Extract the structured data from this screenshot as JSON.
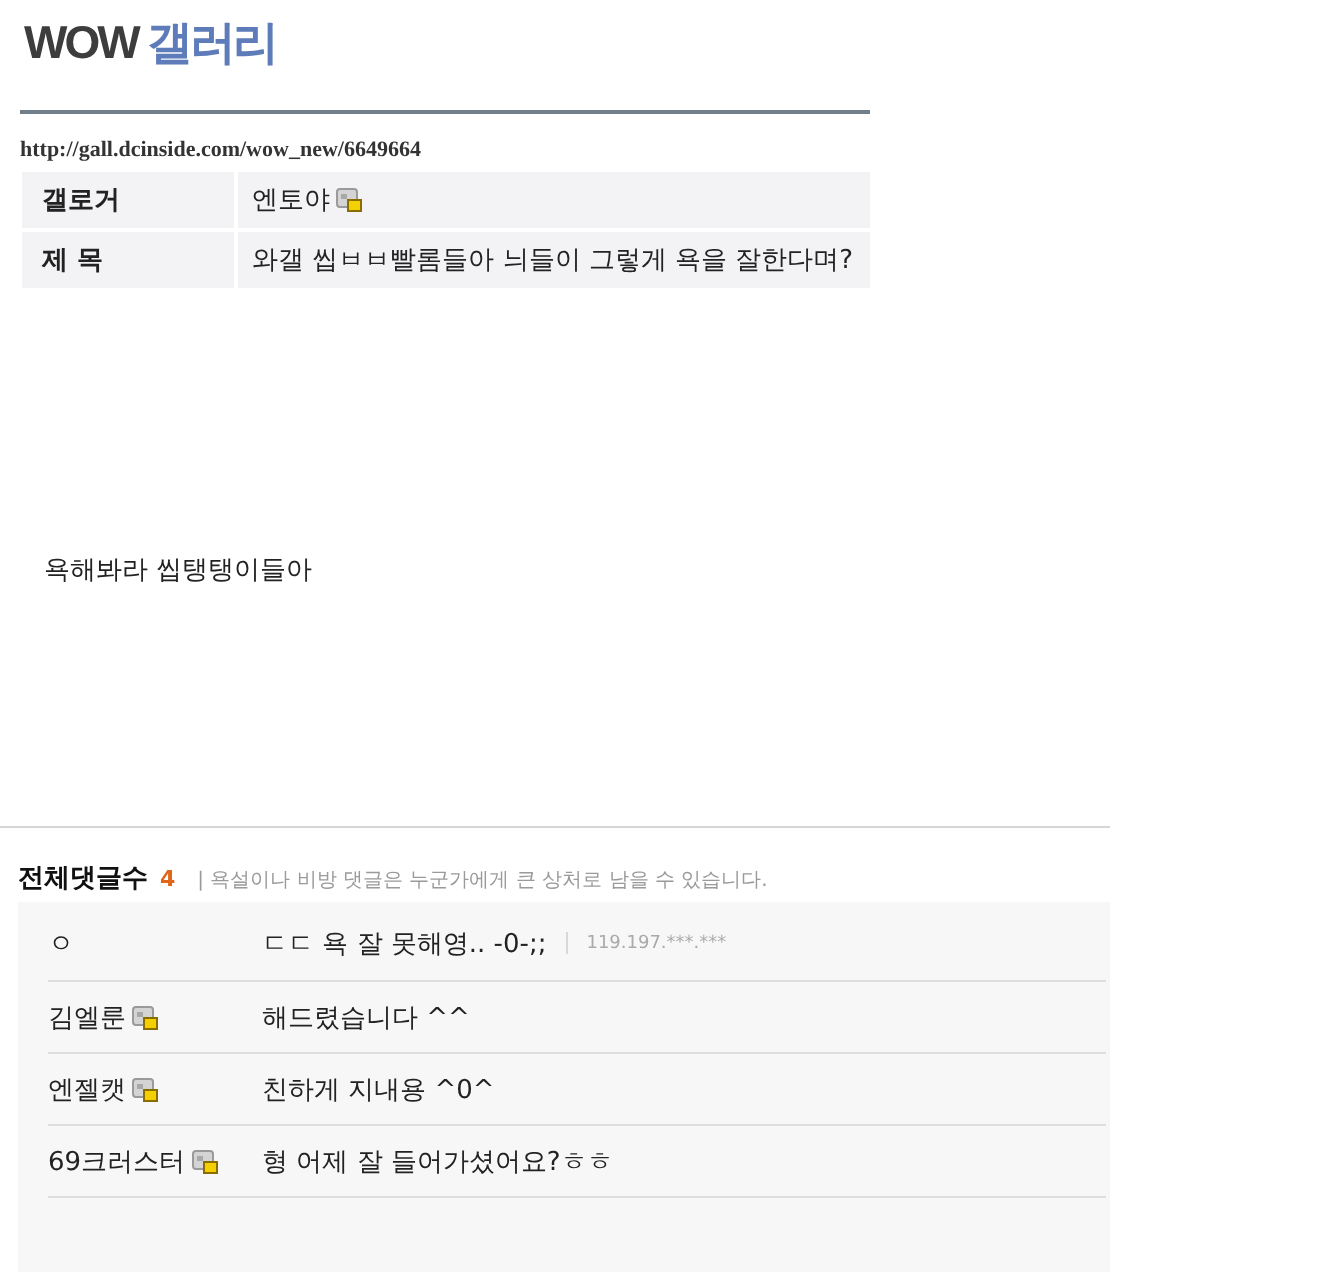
{
  "title": {
    "prefix": "WOW",
    "name": "갤러리"
  },
  "url": "http://gall.dcinside.com/wow_new/6649664",
  "info": [
    {
      "label": "갤로거",
      "value": "엔토야",
      "gallog_icon": true
    },
    {
      "label": "제 목",
      "value": "와갤 씹ㅂㅂ빨롬들아 늬들이 그렇게 욕을 잘한다며?",
      "gallog_icon": false
    }
  ],
  "body": "욕해봐라 씹탱탱이들아",
  "comments_header": {
    "label": "전체댓글수",
    "count": "4",
    "notice": "| 욕설이나 비방 댓글은 누군가에게 큰 상처로 남을 수 있습니다."
  },
  "comments": [
    {
      "name": "ㅇ",
      "gallog_icon": false,
      "text": "ㄷㄷ 욕 잘 못해영.. -0-;;",
      "ip": "119.197.***.***"
    },
    {
      "name": "김엘룬",
      "gallog_icon": true,
      "text": "해드렸습니다 ^^"
    },
    {
      "name": "엔젤캣",
      "gallog_icon": true,
      "text": "친하게 지내용 ^0^"
    },
    {
      "name": "69크러스터",
      "gallog_icon": true,
      "text": "형 어제 잘 들어가셨어요?ㅎㅎ"
    }
  ]
}
